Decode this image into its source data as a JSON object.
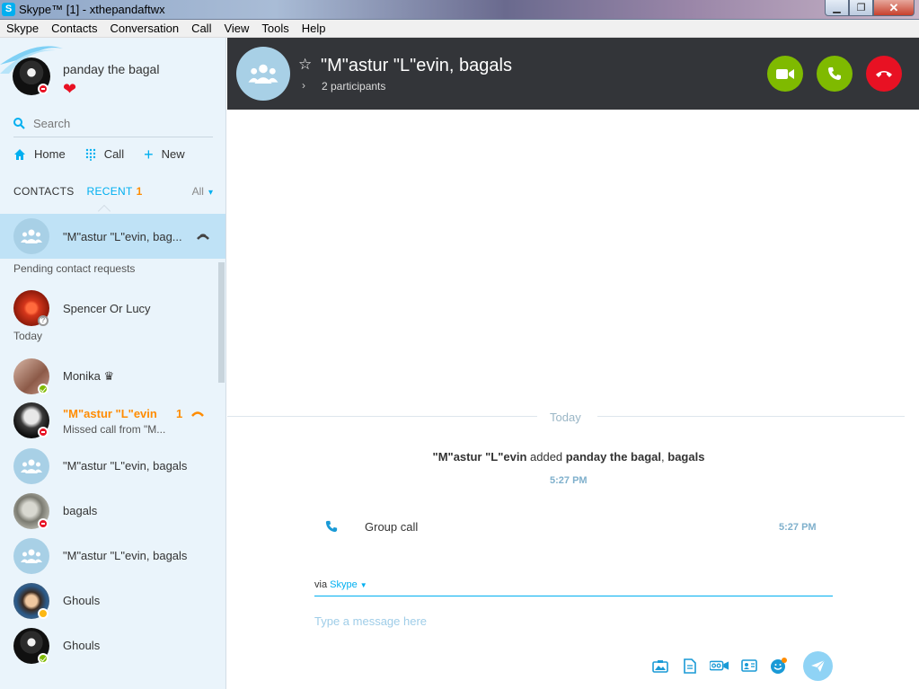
{
  "window": {
    "title": "Skype™ [1] - xthepandaftwx",
    "app_icon": "S",
    "controls": [
      "minimize-icon",
      "restore-icon",
      "close-icon"
    ]
  },
  "menu": [
    "Skype",
    "Contacts",
    "Conversation",
    "Call",
    "View",
    "Tools",
    "Help"
  ],
  "profile": {
    "name": "panday the bagal",
    "status": "busy",
    "mood": "❤"
  },
  "search": {
    "placeholder": "Search"
  },
  "nav": {
    "home": "Home",
    "call": "Call",
    "new": "New"
  },
  "tabs": {
    "contacts": "CONTACTS",
    "recent": "RECENT",
    "recent_count": "1",
    "filter": "All"
  },
  "sidebar_list": {
    "selected": {
      "name": "\"M\"astur \"L\"evin, bag..."
    },
    "pending_header": "Pending contact requests",
    "pending": [
      {
        "name": "Spencer Or Lucy",
        "status": "unknown"
      }
    ],
    "today_header": "Today",
    "items": [
      {
        "name": "Monika ♛",
        "status": "online"
      },
      {
        "name": "\"M\"astur \"L\"evin",
        "count": "1",
        "sub": "Missed call from \"M...",
        "status": "busy"
      },
      {
        "name": "\"M\"astur \"L\"evin, bagals",
        "group": true
      },
      {
        "name": "bagals",
        "status": "busy"
      },
      {
        "name": "\"M\"astur \"L\"evin, bagals",
        "group": true
      },
      {
        "name": "Ghouls",
        "status": "away"
      },
      {
        "name": "Ghouls",
        "status": "online"
      }
    ]
  },
  "conversation": {
    "title": "\"M\"astur \"L\"evin, bagals",
    "participants": "2 participants",
    "day_divider": "Today",
    "system_message": {
      "actor": "\"M\"astur \"L\"evin",
      "verb": "added",
      "targets": "panday the bagal",
      "sep": ",",
      "targets2": "bagals",
      "time": "5:27 PM"
    },
    "call_event": {
      "label": "Group call",
      "time": "5:27 PM"
    },
    "via_label": "via",
    "via_service": "Skype",
    "composer_placeholder": "Type a message here"
  },
  "colors": {
    "accent": "#00aff0",
    "call_green": "#7fba00",
    "hangup_red": "#e81123",
    "unread_orange": "#ff8c00"
  }
}
